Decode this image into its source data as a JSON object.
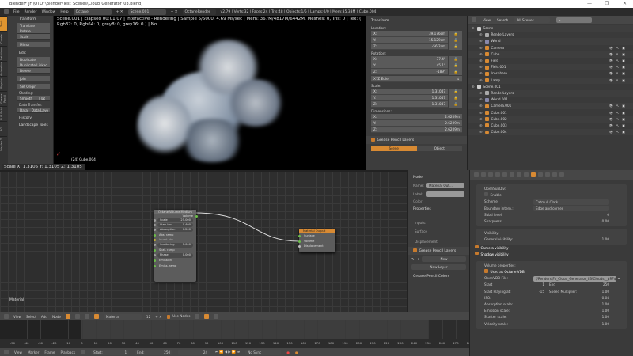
{
  "window": {
    "title": "Blender* [F:\\OTOY\\Blender\\Test_Scenes\\Cloud_Generator_03.blend]",
    "minimize": "—",
    "maximize": "❐",
    "close": "✕"
  },
  "menubar": {
    "items": [
      "File",
      "Render",
      "Window",
      "Help"
    ],
    "layout": "Octane",
    "scene": "Scene.001",
    "engine": "OctaneRender",
    "stats": "v2.79 | Verts:32 | Faces:24 | Tris:48 | Objects:1/5 | Lamps:0/0 | Mem:35.33M | Cube.004"
  },
  "toolshelf": {
    "tabs": [
      "Tools",
      "Create",
      "Relations",
      "Animation",
      "Physics",
      "Grease Pencil",
      "FLIP Fluid",
      "BG",
      "Display Tr."
    ],
    "transform_header": "Transform",
    "transform": [
      "Translate",
      "Rotate",
      "Scale"
    ],
    "mirror": "Mirror",
    "edit_header": "Edit",
    "edit": [
      "Duplicate",
      "Duplicate Linked",
      "Delete"
    ],
    "join": "Join",
    "set_origin": "Set Origin",
    "shading_label": "Shading:",
    "smooth": "Smooth",
    "flat": "Flat",
    "data_transfer_label": "Data Transfer:",
    "data": "Data",
    "data_layers": "Data Layo",
    "history": "History",
    "landscape": "Landscape Tools"
  },
  "viewport": {
    "status": "Scene.001 | Elapsed 00:01.07 | Interactive - Rendering | Sample 5/5000, 4.69 Ms/sec | Mem: 367M/4817M/6442M, Meshes: 0, Tris: 0 | Tex: ( Rgb32: 0, Rgb64: 0, grey8: 0, grey16: 0 ) | No",
    "object_label": "(24) Cube.004",
    "scale_readout": "Scale X: 1.3105  Y: 1.3105  Z: 1.3105"
  },
  "npanel": {
    "header": "Transform",
    "location_label": "Location:",
    "location": [
      [
        "X:",
        "39.176cm"
      ],
      [
        "Y:",
        "15.129cm"
      ],
      [
        "Z:",
        "-56.2cm"
      ]
    ],
    "rotation_label": "Rotation:",
    "rotation": [
      [
        "X:",
        "-37.4°"
      ],
      [
        "Y:",
        "45.1°"
      ],
      [
        "Z:",
        "-189°"
      ]
    ],
    "rotation_mode": "XYZ Euler",
    "scale_label": "Scale:",
    "scale": [
      [
        "X:",
        "1.31047"
      ],
      [
        "Y:",
        "1.31047"
      ],
      [
        "Z:",
        "1.31047"
      ]
    ],
    "dimensions_label": "Dimensions:",
    "dimensions": [
      [
        "X:",
        "2.6209m"
      ],
      [
        "Y:",
        "2.6209m"
      ],
      [
        "Z:",
        "2.6209m"
      ]
    ],
    "grease_pencil": "Grease Pencil Layers",
    "scene_tab": "Scene",
    "object_tab": "Object"
  },
  "outliner": {
    "view": "View",
    "search": "Search",
    "filter": "All Scenes",
    "rows": [
      {
        "name": "Scene",
        "indent": 0,
        "icon": "scene"
      },
      {
        "name": "RenderLayers",
        "indent": 1,
        "icon": "renderlayers"
      },
      {
        "name": "World",
        "indent": 1,
        "icon": "world"
      },
      {
        "name": "Camera",
        "indent": 1,
        "icon": "camera",
        "vis": true
      },
      {
        "name": "Cube",
        "indent": 1,
        "icon": "mesh",
        "vis": true
      },
      {
        "name": "Field",
        "indent": 1,
        "icon": "field",
        "vis": true
      },
      {
        "name": "Field.001",
        "indent": 1,
        "icon": "field",
        "vis": true
      },
      {
        "name": "Icosphere",
        "indent": 1,
        "icon": "mesh",
        "vis": true
      },
      {
        "name": "Lamp",
        "indent": 1,
        "icon": "lamp",
        "vis": true
      },
      {
        "name": "Scene.001",
        "indent": 0,
        "icon": "scene"
      },
      {
        "name": "RenderLayers",
        "indent": 1,
        "icon": "renderlayers"
      },
      {
        "name": "World.001",
        "indent": 1,
        "icon": "world"
      },
      {
        "name": "Camera.001",
        "indent": 1,
        "icon": "camera",
        "vis": true
      },
      {
        "name": "Cube.001",
        "indent": 1,
        "icon": "mesh",
        "vis": true
      },
      {
        "name": "Cube.002",
        "indent": 1,
        "icon": "mesh",
        "vis": true
      },
      {
        "name": "Cube.003",
        "indent": 1,
        "icon": "mesh",
        "vis": true
      },
      {
        "name": "Cube.004",
        "indent": 1,
        "icon": "mesh-selected",
        "vis": true
      }
    ]
  },
  "nodes": {
    "volume": {
      "title": "Octane Volume Medium",
      "output": "Volume",
      "fields": [
        [
          "Scale",
          "25.000"
        ],
        [
          "Step len.",
          "0.400"
        ],
        [
          "Absorption",
          "0.200"
        ]
      ],
      "abs_ramp": "Abs. ramp",
      "invert": "Invert abs.",
      "scattering": [
        "Scattering",
        "1.000"
      ],
      "scat_ramp": "Scat. ramp",
      "phase": [
        "Phase",
        "0.000"
      ],
      "emission": "Emission",
      "emiss_ramp": "Emiss. ramp"
    },
    "output": {
      "title": "Material Output",
      "sockets": [
        "Surface",
        "Volume",
        "Displacement"
      ]
    },
    "editor_label": "Material"
  },
  "node_side": {
    "node_header": "Node",
    "name_label": "Name:",
    "name_value": "Material Out...",
    "label_label": "Label:",
    "color": "Color",
    "properties": "Properties",
    "inputs": "Inputs:",
    "surface": "Surface",
    "displacement": "Displacement",
    "gp_layers": "Grease Pencil Layers",
    "new": "New",
    "new_layer": "New Layer",
    "gp_colors": "Grease Pencil Colors"
  },
  "properties": {
    "opensubdiv": "OpenSubDiv:",
    "enable": "Enable",
    "scheme_label": "Scheme:",
    "scheme": "Catmull Clark",
    "boundary_label": "Boundary interp.:",
    "boundary": "Edge and corner",
    "subd_label": "Subd level:",
    "subd": "0",
    "sharp_label": "Sharpness:",
    "sharp": "0.00",
    "visibility": "Visibility:",
    "gen_vis_label": "General visibility:",
    "gen_vis": "1.00",
    "camera_vis": "Camera visibility",
    "shadow_vis": "Shadow visibility",
    "volume_props": "Volume properties:",
    "used_vdb": "Used as Octane VDB",
    "vdb_file_label": "OpenVDB File:",
    "vdb_file": "//Renders\\Fx_Cloud_Generator_03\\Clouds__$RF$_02...",
    "start_label": "Start",
    "start": "1",
    "end_label": "End",
    "end": "250",
    "play_label": "Start Playing at:",
    "play": "-15",
    "speed_label": "Speed Multiplier:",
    "speed": "1.00",
    "scales": [
      [
        "ISO:",
        "0.04"
      ],
      [
        "Absorption scale:",
        "1.00"
      ],
      [
        "Emission scale:",
        "1.00"
      ],
      [
        "Scatter scale:",
        "1.00"
      ],
      [
        "Velocity scale:",
        "1.00"
      ]
    ]
  },
  "node_header": {
    "menus": [
      "View",
      "Select",
      "Add",
      "Node"
    ],
    "material": "Material",
    "users": "12",
    "use_nodes": "Use Nodes"
  },
  "timeline": {
    "ticks": [
      -50,
      -40,
      -30,
      -20,
      -10,
      0,
      10,
      20,
      30,
      40,
      50,
      60,
      70,
      80,
      90,
      100,
      110,
      120,
      130,
      140,
      150,
      160,
      170,
      180,
      190,
      200,
      210,
      220,
      230,
      240,
      250,
      260,
      270,
      280
    ],
    "current_frame": 24,
    "start": 1,
    "end": 250,
    "menus": [
      "View",
      "Marker",
      "Frame",
      "Playback"
    ],
    "start_label": "Start:",
    "end_label": "End:",
    "frame": "24",
    "sync": "No Sync"
  },
  "colors": {
    "accent": "#d88a33",
    "active_frame": "#6cbf4a",
    "node_output_header": "#d88a33"
  }
}
